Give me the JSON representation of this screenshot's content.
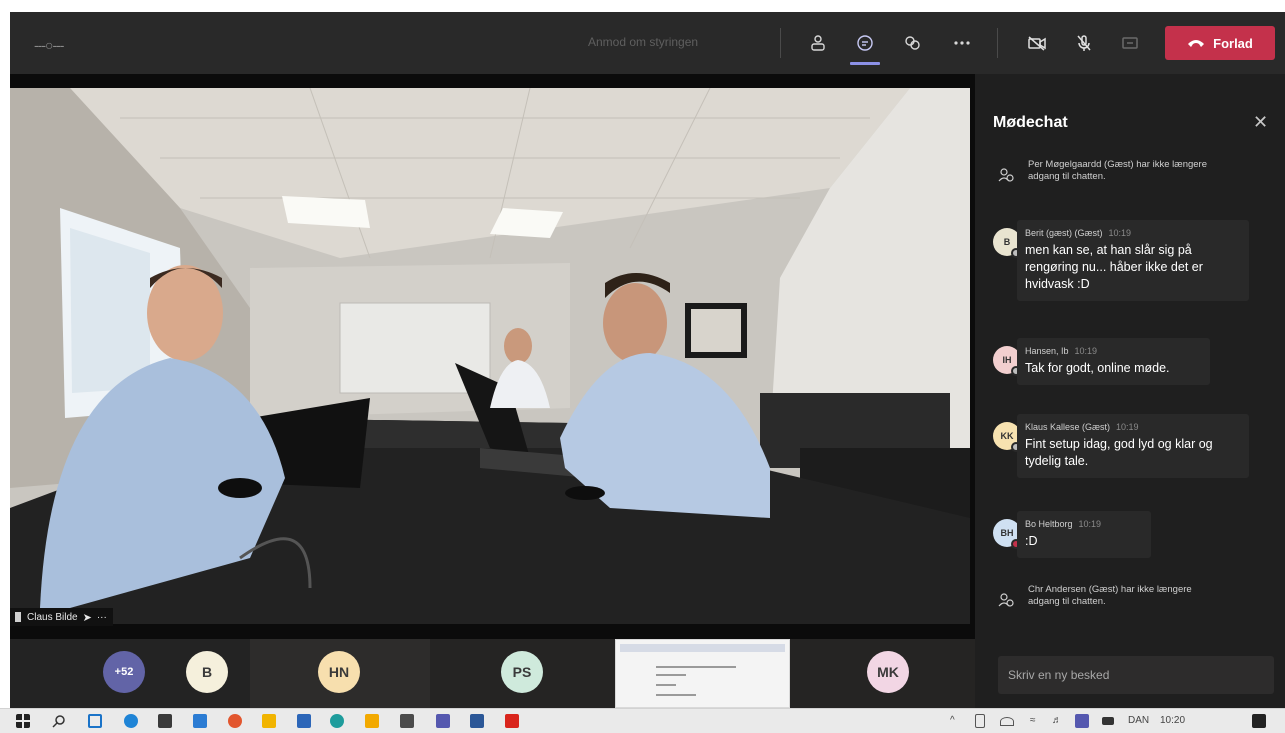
{
  "topbar": {
    "menu": "---○---",
    "request_label": "Anmod om styringen",
    "leave_label": "Forlad",
    "colors": {
      "accent": "#8c91e6",
      "leave": "#c4314b"
    }
  },
  "video": {
    "speaker_name": "Claus Bilde",
    "more": "···"
  },
  "participants": {
    "overflow_count": "+52",
    "avatars": [
      {
        "initials": "B",
        "color": "#f5f0dc"
      },
      {
        "initials": "HN",
        "color": "#f7dfae"
      },
      {
        "initials": "PS",
        "color": "#cfeadc"
      },
      {
        "initials": "MK",
        "color": "#f2d6e4"
      }
    ]
  },
  "chat": {
    "title": "Mødechat",
    "close": "✕",
    "system_messages": [
      "Per Møgelgaardd (Gæst) har ikke længere adgang til chatten.",
      "Chr Andersen (Gæst) har ikke længere adgang til chatten."
    ],
    "messages": [
      {
        "initials": "B",
        "author": "Berit (gæst) (Gæst)",
        "time": "10:19",
        "text": "men kan se, at han slår sig på rengøring nu... håber ikke det er hvidvask :D",
        "avatar_color": "#e9e4d0"
      },
      {
        "initials": "IH",
        "author": "Hansen, Ib",
        "time": "10:19",
        "text": "Tak for godt, online møde.",
        "avatar_color": "#f2cfcf"
      },
      {
        "initials": "KK",
        "author": "Klaus Kallese (Gæst)",
        "time": "10:19",
        "text": "Fint setup idag, god lyd og klar og tydelig tale.",
        "avatar_color": "#f7e2b0"
      },
      {
        "initials": "BH",
        "author": "Bo Heltborg",
        "time": "10:19",
        "text": ":D",
        "avatar_color": "#cfe0f2"
      }
    ],
    "compose_placeholder": "Skriv en ny besked"
  },
  "taskbar": {
    "language": "DAN",
    "clock": "10:20"
  }
}
